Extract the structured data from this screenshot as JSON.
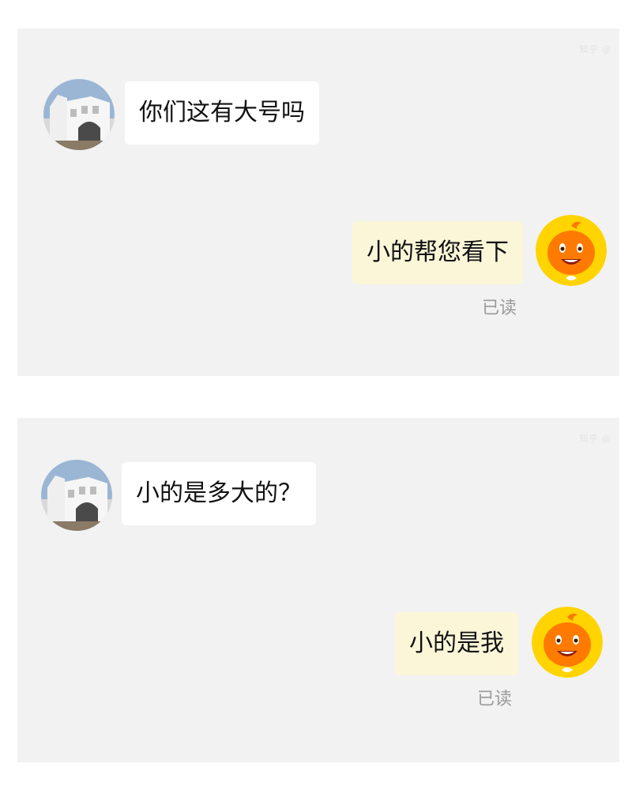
{
  "conversations": [
    {
      "watermark": "知乎 @",
      "customer_message": "你们这有大号吗",
      "agent_message": "小的帮您看下",
      "read_status": "已读"
    },
    {
      "watermark": "知乎 @",
      "customer_message": "小的是多大的？",
      "agent_message": "小的是我",
      "read_status": "已读"
    }
  ],
  "colors": {
    "panel_background": "#f2f2f2",
    "customer_bubble": "#ffffff",
    "agent_bubble": "#fbf6d8",
    "agent_avatar": "#ff7a00",
    "agent_avatar_ring": "#ffd400",
    "read_status_text": "#9a9a9a"
  },
  "icons": {
    "customer_avatar": "building-photo-avatar",
    "agent_avatar": "orange-mascot-avatar"
  }
}
